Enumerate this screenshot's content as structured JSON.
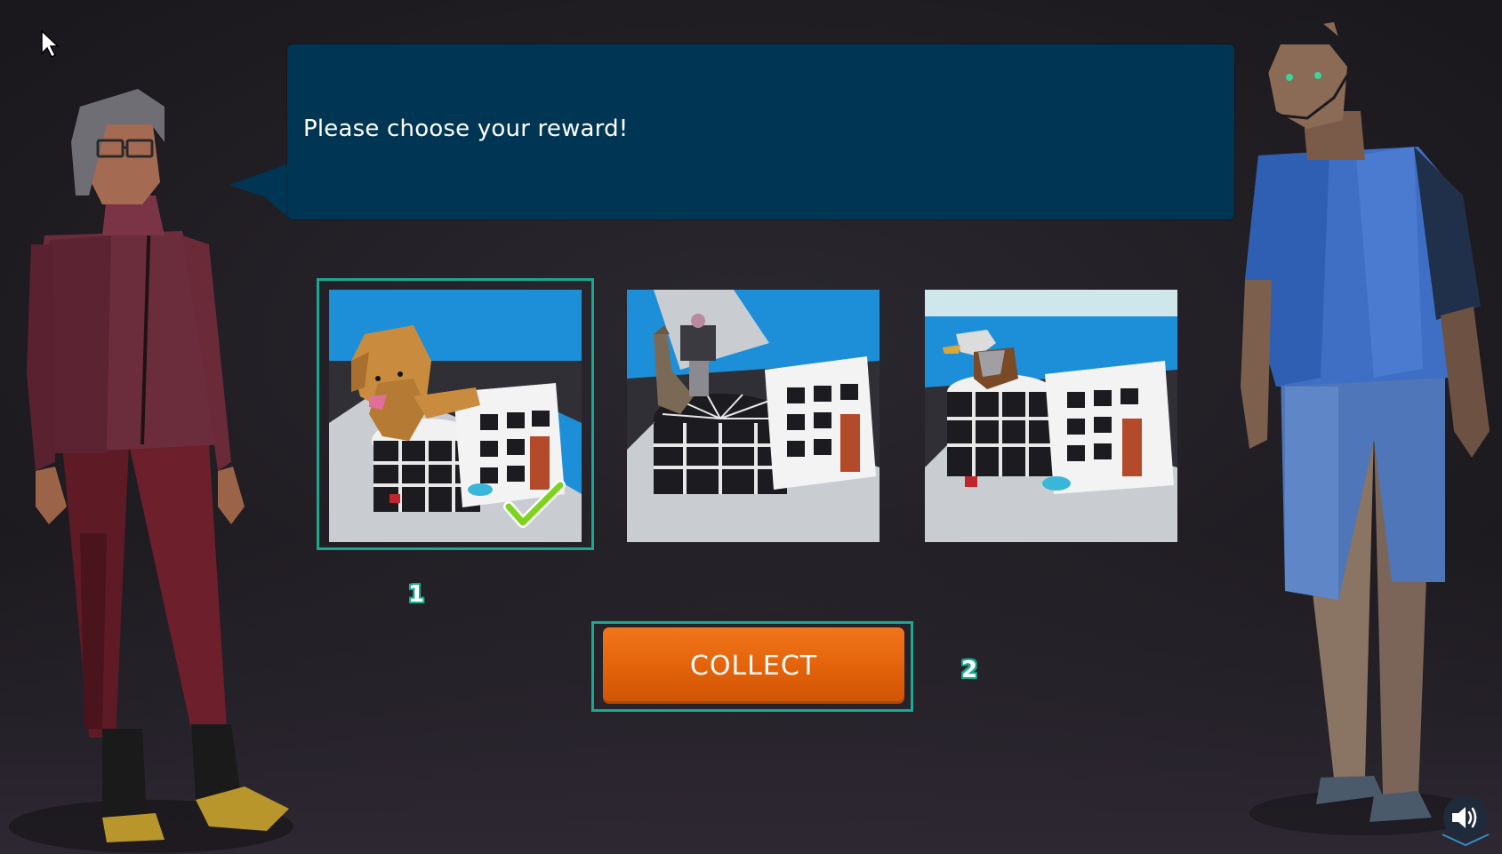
{
  "dialog": {
    "message": "Please choose your reward!"
  },
  "rewards": [
    {
      "name": "Dog on building",
      "selected": true
    },
    {
      "name": "Llama on building",
      "selected": false
    },
    {
      "name": "Eagle on building",
      "selected": false
    }
  ],
  "steps": {
    "marker_1": "1",
    "marker_2": "2"
  },
  "collect_button": {
    "label": "COLLECT"
  },
  "icons": {
    "cursor": "mouse-pointer-icon",
    "check": "checkmark-icon",
    "sound": "speaker-icon",
    "expand": "chevron-down-icon"
  },
  "colors": {
    "background": "#211e24",
    "bubble": "#003554",
    "accent": "#1aa98e",
    "button": "#e2620a",
    "check": "#7ed321"
  }
}
